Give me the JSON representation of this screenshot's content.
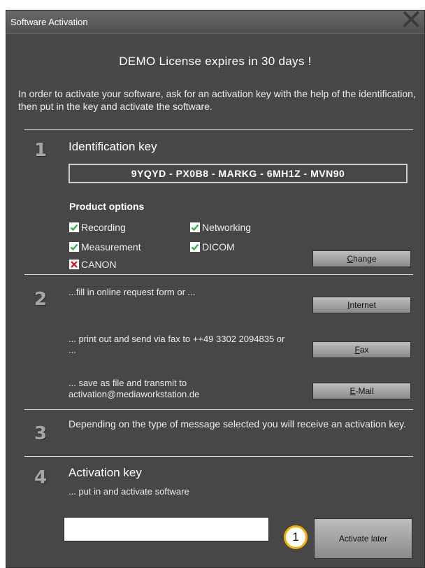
{
  "window": {
    "title": "Software Activation"
  },
  "headline": "DEMO License expires in 30 days !",
  "intro": "In order to activate your software, ask for an activation key with the help of the identification, then put in the key and activate the software.",
  "step1": {
    "number": "1",
    "heading": "Identification key",
    "key": "9YQYD - PX0B8 - MARKG - 6MH1Z - MVN90",
    "options_title": "Product options",
    "options": [
      {
        "label": "Recording",
        "checked": true
      },
      {
        "label": "Networking",
        "checked": true
      },
      {
        "label": "Measurement",
        "checked": true
      },
      {
        "label": "DICOM",
        "checked": true
      },
      {
        "label": "CANON",
        "checked": false
      }
    ],
    "change_label_ul": "C",
    "change_label_rest": "hange"
  },
  "step2": {
    "number": "2",
    "online_text": "...fill in online request form or ...",
    "internet_ul": "I",
    "internet_rest": "nternet",
    "fax_text": "... print out and send via fax to ++49 3302 2094835 or ...",
    "fax_ul": "F",
    "fax_rest": "ax",
    "email_text": "... save as file and transmit to activation@mediaworkstation.de",
    "email_ul": "E",
    "email_rest": "-Mail"
  },
  "step3": {
    "number": "3",
    "text": "Depending on the type of message selected you will receive an activation key."
  },
  "step4": {
    "number": "4",
    "heading": "Activation key",
    "subtext": "... put in and activate software",
    "input_value": "",
    "activate_label": "Activate later"
  },
  "callout": {
    "number": "1"
  },
  "colors": {
    "check_green": "#2fb34a",
    "cross_red": "#d0202a",
    "badge_ring": "#f5b000"
  }
}
